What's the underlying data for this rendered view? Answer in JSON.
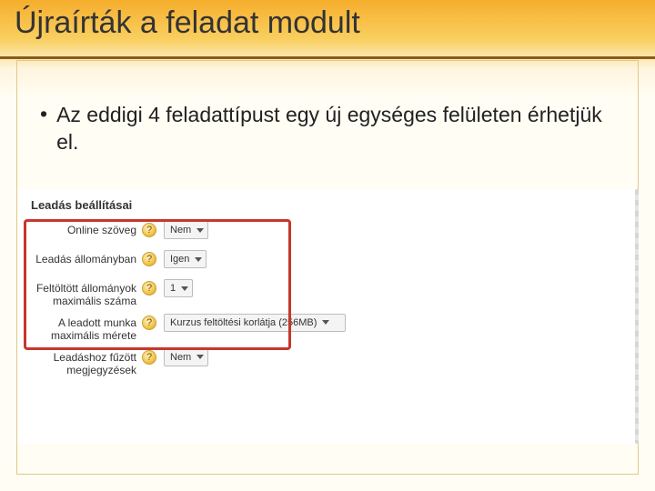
{
  "title": "Újraírták a feladat modult",
  "bullet": "Az eddigi 4 feladattípust egy új egységes felületen érhetjük el.",
  "panel": {
    "heading": "Leadás beállításai",
    "rows": [
      {
        "label": "Online szöveg",
        "value": "Nem"
      },
      {
        "label": "Leadás állományban",
        "value": "Igen"
      },
      {
        "label": "Feltöltött állományok maximális száma",
        "value": "1"
      },
      {
        "label": "A leadott munka maximális mérete",
        "value": "Kurzus feltöltési korlátja (256MB)"
      },
      {
        "label": "Leadáshoz fűzött megjegyzések",
        "value": "Nem"
      }
    ]
  }
}
